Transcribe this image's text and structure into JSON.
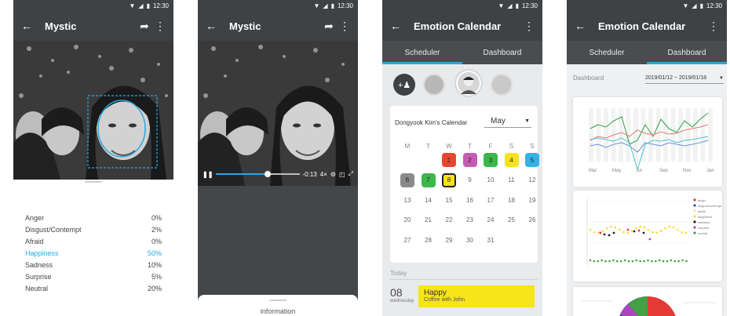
{
  "status": {
    "time": "12:30"
  },
  "screen1": {
    "title": "Mystic",
    "emotions": [
      {
        "name": "Anger",
        "value": "0%"
      },
      {
        "name": "Disgust/Contempt",
        "value": "2%"
      },
      {
        "name": "Afraid",
        "value": "0%"
      },
      {
        "name": "Happiness",
        "value": "50%",
        "highlight": true
      },
      {
        "name": "Sadness",
        "value": "10%"
      },
      {
        "name": "Surprise",
        "value": "5%"
      },
      {
        "name": "Neutral",
        "value": "20%"
      }
    ]
  },
  "screen2": {
    "title": "Mystic",
    "player": {
      "time": "-0:13",
      "speed": "4×",
      "progress": 0.62
    },
    "sheet_label": "information"
  },
  "screen3": {
    "title": "Emotion Calendar",
    "tabs": [
      "Scheduler",
      "Dashboard"
    ],
    "calendar_title": "Dongyook Kim's  Calendar",
    "month": "May",
    "weekdays": [
      "M",
      "T",
      "W",
      "T",
      "F",
      "S",
      "S"
    ],
    "days": [
      [
        "",
        "",
        "1",
        "2",
        "3",
        "4",
        "5"
      ],
      [
        "6",
        "7",
        "8",
        "9",
        "10",
        "11",
        "12"
      ],
      [
        "13",
        "14",
        "15",
        "16",
        "17",
        "18",
        "19"
      ],
      [
        "20",
        "21",
        "22",
        "23",
        "24",
        "25",
        "26"
      ],
      [
        "27",
        "28",
        "29",
        "30",
        "31",
        "",
        ""
      ]
    ],
    "today_label": "Today",
    "today_day": "08",
    "today_weekday": "wednesday",
    "event_title": "Happy",
    "event_sub": "Coffee with John",
    "colors": {
      "red": "#e8472f",
      "magenta": "#c65bb0",
      "green": "#3cb74a",
      "yellow": "#f5e21b",
      "blue": "#36b1e6",
      "gray": "#8a8a8a"
    }
  },
  "screen4": {
    "title": "Emotion Calendar",
    "tabs": [
      "Scheduler",
      "Dashboard"
    ],
    "dashboard_label": "Dashboard",
    "date_range": "2019/01/12 ~ 2019/01/18",
    "line_chart_months": [
      "Mar",
      "May",
      "Jul",
      "Sep",
      "Nov",
      "Jan"
    ],
    "legend": [
      "anger",
      "disgust/contempt",
      "afraid",
      "happiness",
      "sadness",
      "surprise",
      "neutral"
    ],
    "legend_colors": [
      "#e53935",
      "#3949ab",
      "#f3e5ab",
      "#fdd835",
      "#212121",
      "#ab47bc",
      "#43a047"
    ]
  }
}
